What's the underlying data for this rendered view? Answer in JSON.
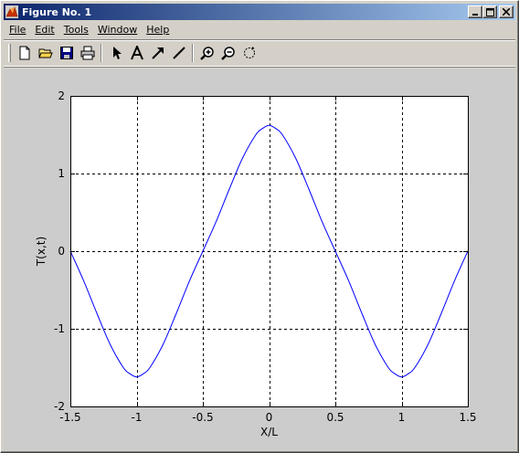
{
  "window": {
    "title": "Figure No. 1"
  },
  "menu": {
    "file": "File",
    "edit": "Edit",
    "tools": "Tools",
    "window": "Window",
    "help": "Help"
  },
  "toolbar": {
    "tools": [
      "new-file-icon",
      "open-folder-icon",
      "save-icon",
      "print-icon",
      "select-arrow-icon",
      "insert-text-icon",
      "insert-arrow-icon",
      "insert-line-icon",
      "zoom-in-icon",
      "zoom-out-icon",
      "rotate-3d-icon"
    ]
  },
  "colors": {
    "line": "#0000ff",
    "figure_bg": "#cccccc",
    "axes_bg": "#ffffff",
    "title_bar_start": "#0a246a",
    "title_bar_end": "#a6caf0"
  },
  "chart_data": {
    "type": "line",
    "xlabel": "X/L",
    "ylabel": "T(x,t)",
    "xlim": [
      -1.5,
      1.5
    ],
    "ylim": [
      -2,
      2
    ],
    "xticks": [
      "-1.5",
      "-1",
      "-0.5",
      "0",
      "0.5",
      "1",
      "1.5"
    ],
    "xtick_values": [
      -1.5,
      -1,
      -0.5,
      0,
      0.5,
      1,
      1.5
    ],
    "yticks": [
      "-2",
      "-1",
      "0",
      "1",
      "2"
    ],
    "ytick_values": [
      -2,
      -1,
      0,
      1,
      2
    ],
    "grid": true,
    "grid_style": "dashed",
    "series": [
      {
        "x": [
          -1.5,
          -1.4,
          -1.3,
          -1.2,
          -1.1,
          -1.05,
          -1.0,
          -0.95,
          -0.9,
          -0.8,
          -0.7,
          -0.6,
          -0.5,
          -0.4,
          -0.3,
          -0.2,
          -0.1,
          -0.05,
          0.0,
          0.05,
          0.1,
          0.2,
          0.3,
          0.4,
          0.5,
          0.6,
          0.7,
          0.8,
          0.9,
          0.95,
          1.0,
          1.05,
          1.1,
          1.2,
          1.3,
          1.4,
          1.5
        ],
        "y": [
          0.0,
          -0.38,
          -0.8,
          -1.2,
          -1.5,
          -1.58,
          -1.62,
          -1.58,
          -1.5,
          -1.2,
          -0.8,
          -0.38,
          0.0,
          0.38,
          0.8,
          1.2,
          1.5,
          1.58,
          1.62,
          1.58,
          1.5,
          1.2,
          0.8,
          0.38,
          0.0,
          -0.38,
          -0.8,
          -1.2,
          -1.5,
          -1.58,
          -1.62,
          -1.58,
          -1.5,
          -1.2,
          -0.8,
          -0.38,
          0.0
        ]
      }
    ]
  }
}
